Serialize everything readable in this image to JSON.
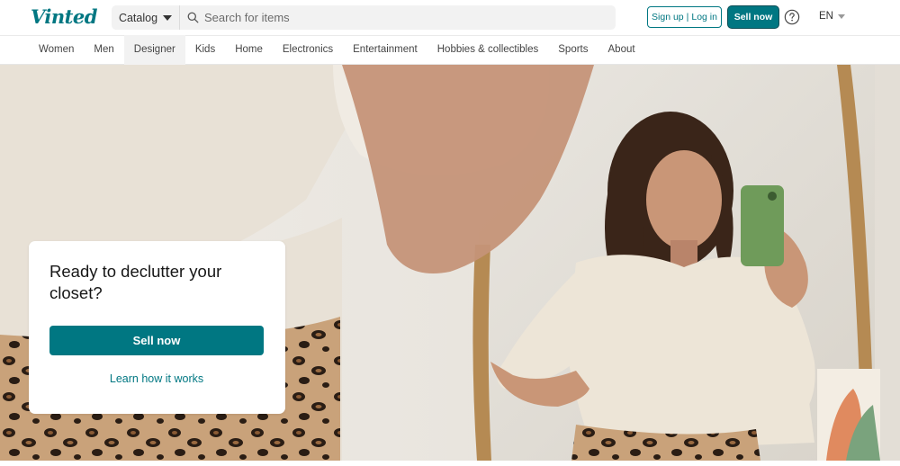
{
  "header": {
    "logo": "Vinted",
    "catalog_label": "Catalog",
    "search_placeholder": "Search for items",
    "signup_label": "Sign up",
    "login_separator": "|",
    "login_label": "Log in",
    "sell_label": "Sell now",
    "language": "EN"
  },
  "nav": {
    "items": [
      "Women",
      "Men",
      "Designer",
      "Kids",
      "Home",
      "Electronics",
      "Entertainment",
      "Hobbies & collectibles",
      "Sports",
      "About"
    ]
  },
  "hero": {
    "title": "Ready to declutter your closet?",
    "sell_label": "Sell now",
    "learn_label": "Learn how it works"
  },
  "colors": {
    "brand": "#007782"
  },
  "icons": {
    "search": "search-icon",
    "help": "help-circle-icon",
    "caret": "chevron-down-icon"
  }
}
